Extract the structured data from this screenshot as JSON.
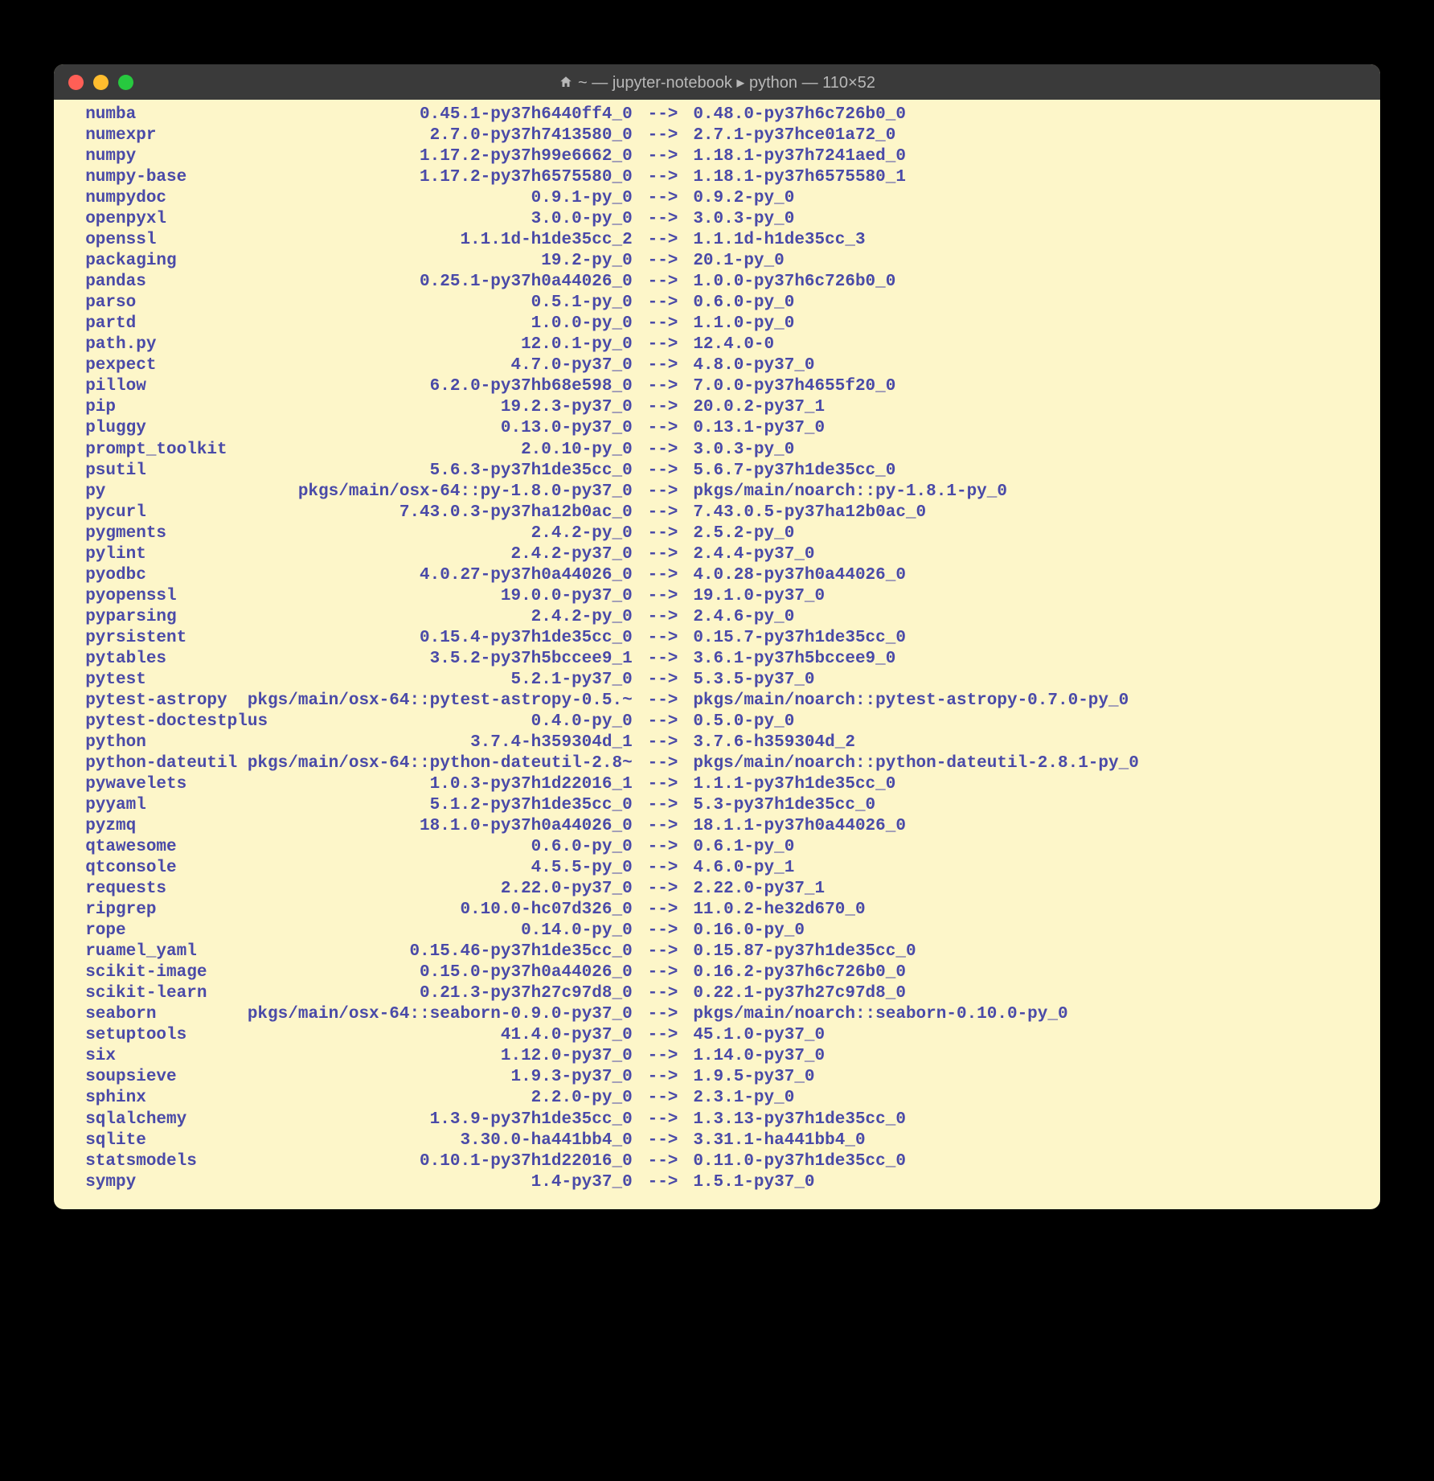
{
  "window": {
    "title": "~ — jupyter-notebook ▸ python — 110×52"
  },
  "arrow": "-->",
  "packages": [
    {
      "name": "numba",
      "from": "0.45.1-py37h6440ff4_0",
      "to": "0.48.0-py37h6c726b0_0"
    },
    {
      "name": "numexpr",
      "from": "2.7.0-py37h7413580_0",
      "to": "2.7.1-py37hce01a72_0"
    },
    {
      "name": "numpy",
      "from": "1.17.2-py37h99e6662_0",
      "to": "1.18.1-py37h7241aed_0"
    },
    {
      "name": "numpy-base",
      "from": "1.17.2-py37h6575580_0",
      "to": "1.18.1-py37h6575580_1"
    },
    {
      "name": "numpydoc",
      "from": "0.9.1-py_0",
      "to": "0.9.2-py_0"
    },
    {
      "name": "openpyxl",
      "from": "3.0.0-py_0",
      "to": "3.0.3-py_0"
    },
    {
      "name": "openssl",
      "from": "1.1.1d-h1de35cc_2",
      "to": "1.1.1d-h1de35cc_3"
    },
    {
      "name": "packaging",
      "from": "19.2-py_0",
      "to": "20.1-py_0"
    },
    {
      "name": "pandas",
      "from": "0.25.1-py37h0a44026_0",
      "to": "1.0.0-py37h6c726b0_0"
    },
    {
      "name": "parso",
      "from": "0.5.1-py_0",
      "to": "0.6.0-py_0"
    },
    {
      "name": "partd",
      "from": "1.0.0-py_0",
      "to": "1.1.0-py_0"
    },
    {
      "name": "path.py",
      "from": "12.0.1-py_0",
      "to": "12.4.0-0"
    },
    {
      "name": "pexpect",
      "from": "4.7.0-py37_0",
      "to": "4.8.0-py37_0"
    },
    {
      "name": "pillow",
      "from": "6.2.0-py37hb68e598_0",
      "to": "7.0.0-py37h4655f20_0"
    },
    {
      "name": "pip",
      "from": "19.2.3-py37_0",
      "to": "20.0.2-py37_1"
    },
    {
      "name": "pluggy",
      "from": "0.13.0-py37_0",
      "to": "0.13.1-py37_0"
    },
    {
      "name": "prompt_toolkit",
      "from": "2.0.10-py_0",
      "to": "3.0.3-py_0"
    },
    {
      "name": "psutil",
      "from": "5.6.3-py37h1de35cc_0",
      "to": "5.6.7-py37h1de35cc_0"
    },
    {
      "name": "py",
      "from": "pkgs/main/osx-64::py-1.8.0-py37_0",
      "to": "pkgs/main/noarch::py-1.8.1-py_0"
    },
    {
      "name": "pycurl",
      "from": "7.43.0.3-py37ha12b0ac_0",
      "to": "7.43.0.5-py37ha12b0ac_0"
    },
    {
      "name": "pygments",
      "from": "2.4.2-py_0",
      "to": "2.5.2-py_0"
    },
    {
      "name": "pylint",
      "from": "2.4.2-py37_0",
      "to": "2.4.4-py37_0"
    },
    {
      "name": "pyodbc",
      "from": "4.0.27-py37h0a44026_0",
      "to": "4.0.28-py37h0a44026_0"
    },
    {
      "name": "pyopenssl",
      "from": "19.0.0-py37_0",
      "to": "19.1.0-py37_0"
    },
    {
      "name": "pyparsing",
      "from": "2.4.2-py_0",
      "to": "2.4.6-py_0"
    },
    {
      "name": "pyrsistent",
      "from": "0.15.4-py37h1de35cc_0",
      "to": "0.15.7-py37h1de35cc_0"
    },
    {
      "name": "pytables",
      "from": "3.5.2-py37h5bccee9_1",
      "to": "3.6.1-py37h5bccee9_0"
    },
    {
      "name": "pytest",
      "from": "5.2.1-py37_0",
      "to": "5.3.5-py37_0"
    },
    {
      "name": "pytest-astropy",
      "from": "pkgs/main/osx-64::pytest-astropy-0.5.~",
      "to": "pkgs/main/noarch::pytest-astropy-0.7.0-py_0"
    },
    {
      "name": "pytest-doctestplus",
      "from": "0.4.0-py_0",
      "to": "0.5.0-py_0"
    },
    {
      "name": "python",
      "from": "3.7.4-h359304d_1",
      "to": "3.7.6-h359304d_2"
    },
    {
      "name": "python-dateutil",
      "from": "pkgs/main/osx-64::python-dateutil-2.8~",
      "to": "pkgs/main/noarch::python-dateutil-2.8.1-py_0"
    },
    {
      "name": "pywavelets",
      "from": "1.0.3-py37h1d22016_1",
      "to": "1.1.1-py37h1de35cc_0"
    },
    {
      "name": "pyyaml",
      "from": "5.1.2-py37h1de35cc_0",
      "to": "5.3-py37h1de35cc_0"
    },
    {
      "name": "pyzmq",
      "from": "18.1.0-py37h0a44026_0",
      "to": "18.1.1-py37h0a44026_0"
    },
    {
      "name": "qtawesome",
      "from": "0.6.0-py_0",
      "to": "0.6.1-py_0"
    },
    {
      "name": "qtconsole",
      "from": "4.5.5-py_0",
      "to": "4.6.0-py_1"
    },
    {
      "name": "requests",
      "from": "2.22.0-py37_0",
      "to": "2.22.0-py37_1"
    },
    {
      "name": "ripgrep",
      "from": "0.10.0-hc07d326_0",
      "to": "11.0.2-he32d670_0"
    },
    {
      "name": "rope",
      "from": "0.14.0-py_0",
      "to": "0.16.0-py_0"
    },
    {
      "name": "ruamel_yaml",
      "from": "0.15.46-py37h1de35cc_0",
      "to": "0.15.87-py37h1de35cc_0"
    },
    {
      "name": "scikit-image",
      "from": "0.15.0-py37h0a44026_0",
      "to": "0.16.2-py37h6c726b0_0"
    },
    {
      "name": "scikit-learn",
      "from": "0.21.3-py37h27c97d8_0",
      "to": "0.22.1-py37h27c97d8_0"
    },
    {
      "name": "seaborn",
      "from": "pkgs/main/osx-64::seaborn-0.9.0-py37_0",
      "to": "pkgs/main/noarch::seaborn-0.10.0-py_0"
    },
    {
      "name": "setuptools",
      "from": "41.4.0-py37_0",
      "to": "45.1.0-py37_0"
    },
    {
      "name": "six",
      "from": "1.12.0-py37_0",
      "to": "1.14.0-py37_0"
    },
    {
      "name": "soupsieve",
      "from": "1.9.3-py37_0",
      "to": "1.9.5-py37_0"
    },
    {
      "name": "sphinx",
      "from": "2.2.0-py_0",
      "to": "2.3.1-py_0"
    },
    {
      "name": "sqlalchemy",
      "from": "1.3.9-py37h1de35cc_0",
      "to": "1.3.13-py37h1de35cc_0"
    },
    {
      "name": "sqlite",
      "from": "3.30.0-ha441bb4_0",
      "to": "3.31.1-ha441bb4_0"
    },
    {
      "name": "statsmodels",
      "from": "0.10.1-py37h1d22016_0",
      "to": "0.11.0-py37h1de35cc_0"
    },
    {
      "name": "sympy",
      "from": "1.4-py37_0",
      "to": "1.5.1-py37_0"
    }
  ]
}
